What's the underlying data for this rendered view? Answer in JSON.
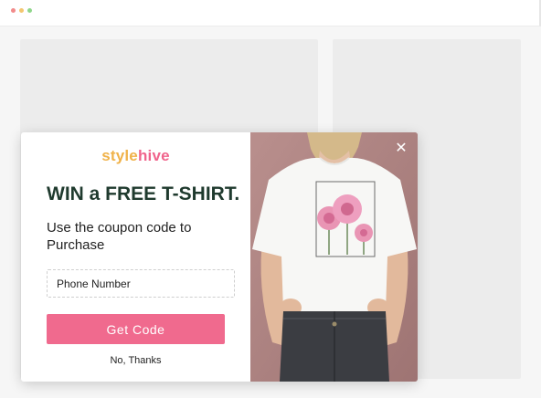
{
  "brand": {
    "part1": "style",
    "part2": "hive"
  },
  "popup": {
    "headline": "WIN a FREE T-SHIRT.",
    "subline": "Use the coupon code to Purchase",
    "phone_placeholder": "Phone Number",
    "cta_label": "Get Code",
    "dismiss_label": "No, Thanks",
    "close_glyph": "✕"
  },
  "colors": {
    "brand_orange": "#f0b249",
    "brand_pink": "#f0648c",
    "cta": "#f06a8e",
    "headline": "#1f3a2e"
  },
  "icons": [
    "close-icon"
  ]
}
